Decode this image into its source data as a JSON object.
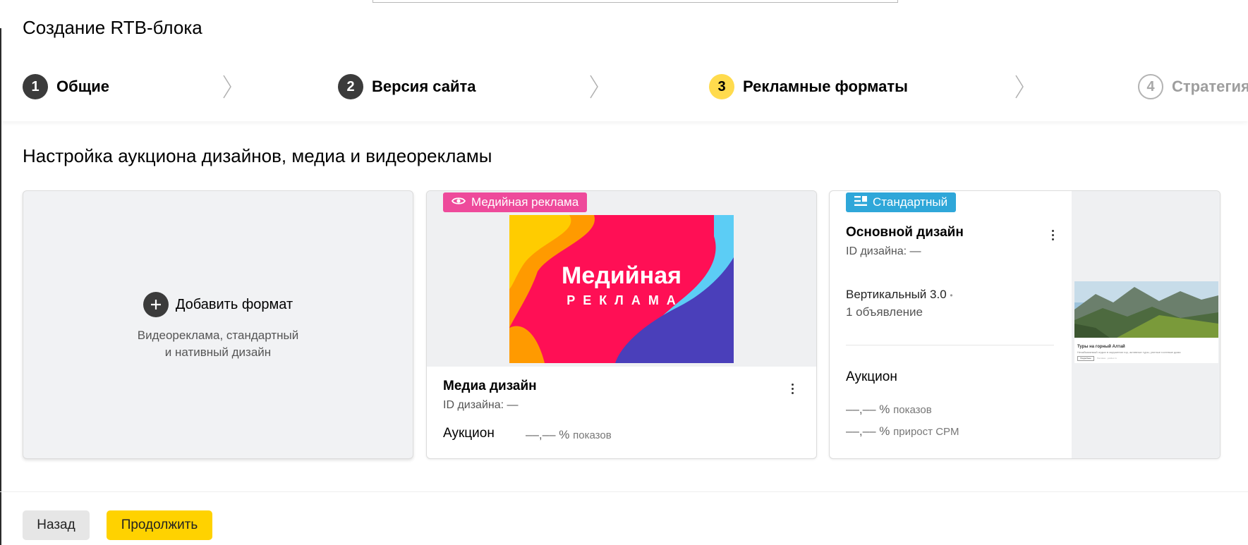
{
  "header": {
    "title": "Создание RTB-блока",
    "steps": [
      {
        "number": "1",
        "label": "Общие",
        "state": "done"
      },
      {
        "number": "2",
        "label": "Версия сайта",
        "state": "done"
      },
      {
        "number": "3",
        "label": "Рекламные форматы",
        "state": "active"
      },
      {
        "number": "4",
        "label": "Стратегия",
        "state": "future"
      }
    ]
  },
  "main": {
    "section_title": "Настройка аукциона дизайнов, медиа и видеорекламы",
    "add_card": {
      "title": "Добавить формат",
      "description_line1": "Видеореклама, стандартный",
      "description_line2": "и нативный дизайн"
    },
    "media_card": {
      "badge": "Медийная реклама",
      "art_title": "Медийная",
      "art_subtitle": "РЕКЛАМА",
      "title": "Медиа дизайн",
      "id_label": "ID дизайна:",
      "id_value": "—",
      "auction_label": "Аукцион",
      "metric_value": "––,–– %",
      "metric_unit": "показов"
    },
    "standard_card": {
      "badge": "Стандартный",
      "title": "Основной дизайн",
      "id_label": "ID дизайна:",
      "id_value": "—",
      "format": "Вертикальный 3.0",
      "separator": "•",
      "ads_count": "1 объявление",
      "auction_label": "Аукцион",
      "metric1_value": "––,–– %",
      "metric1_unit": "показов",
      "metric2_value": "––,–– %",
      "metric2_unit": "прирост CPM",
      "preview": {
        "headline": "Туры на горный Алтай",
        "subtitle": "Незабываемый отдых в окружении гор, активные туры, уютные гостевые дома",
        "button": "Подробнее",
        "note": "Реклама · yandex.ru"
      }
    }
  },
  "footer": {
    "back_label": "Назад",
    "continue_label": "Продолжить"
  },
  "colors": {
    "accent": "#ffdb4d",
    "continue_button": "#ffd200",
    "media_badge": "#ee4a9b",
    "standard_badge": "#2fa7d9",
    "step_done": "#3b3b3b"
  }
}
